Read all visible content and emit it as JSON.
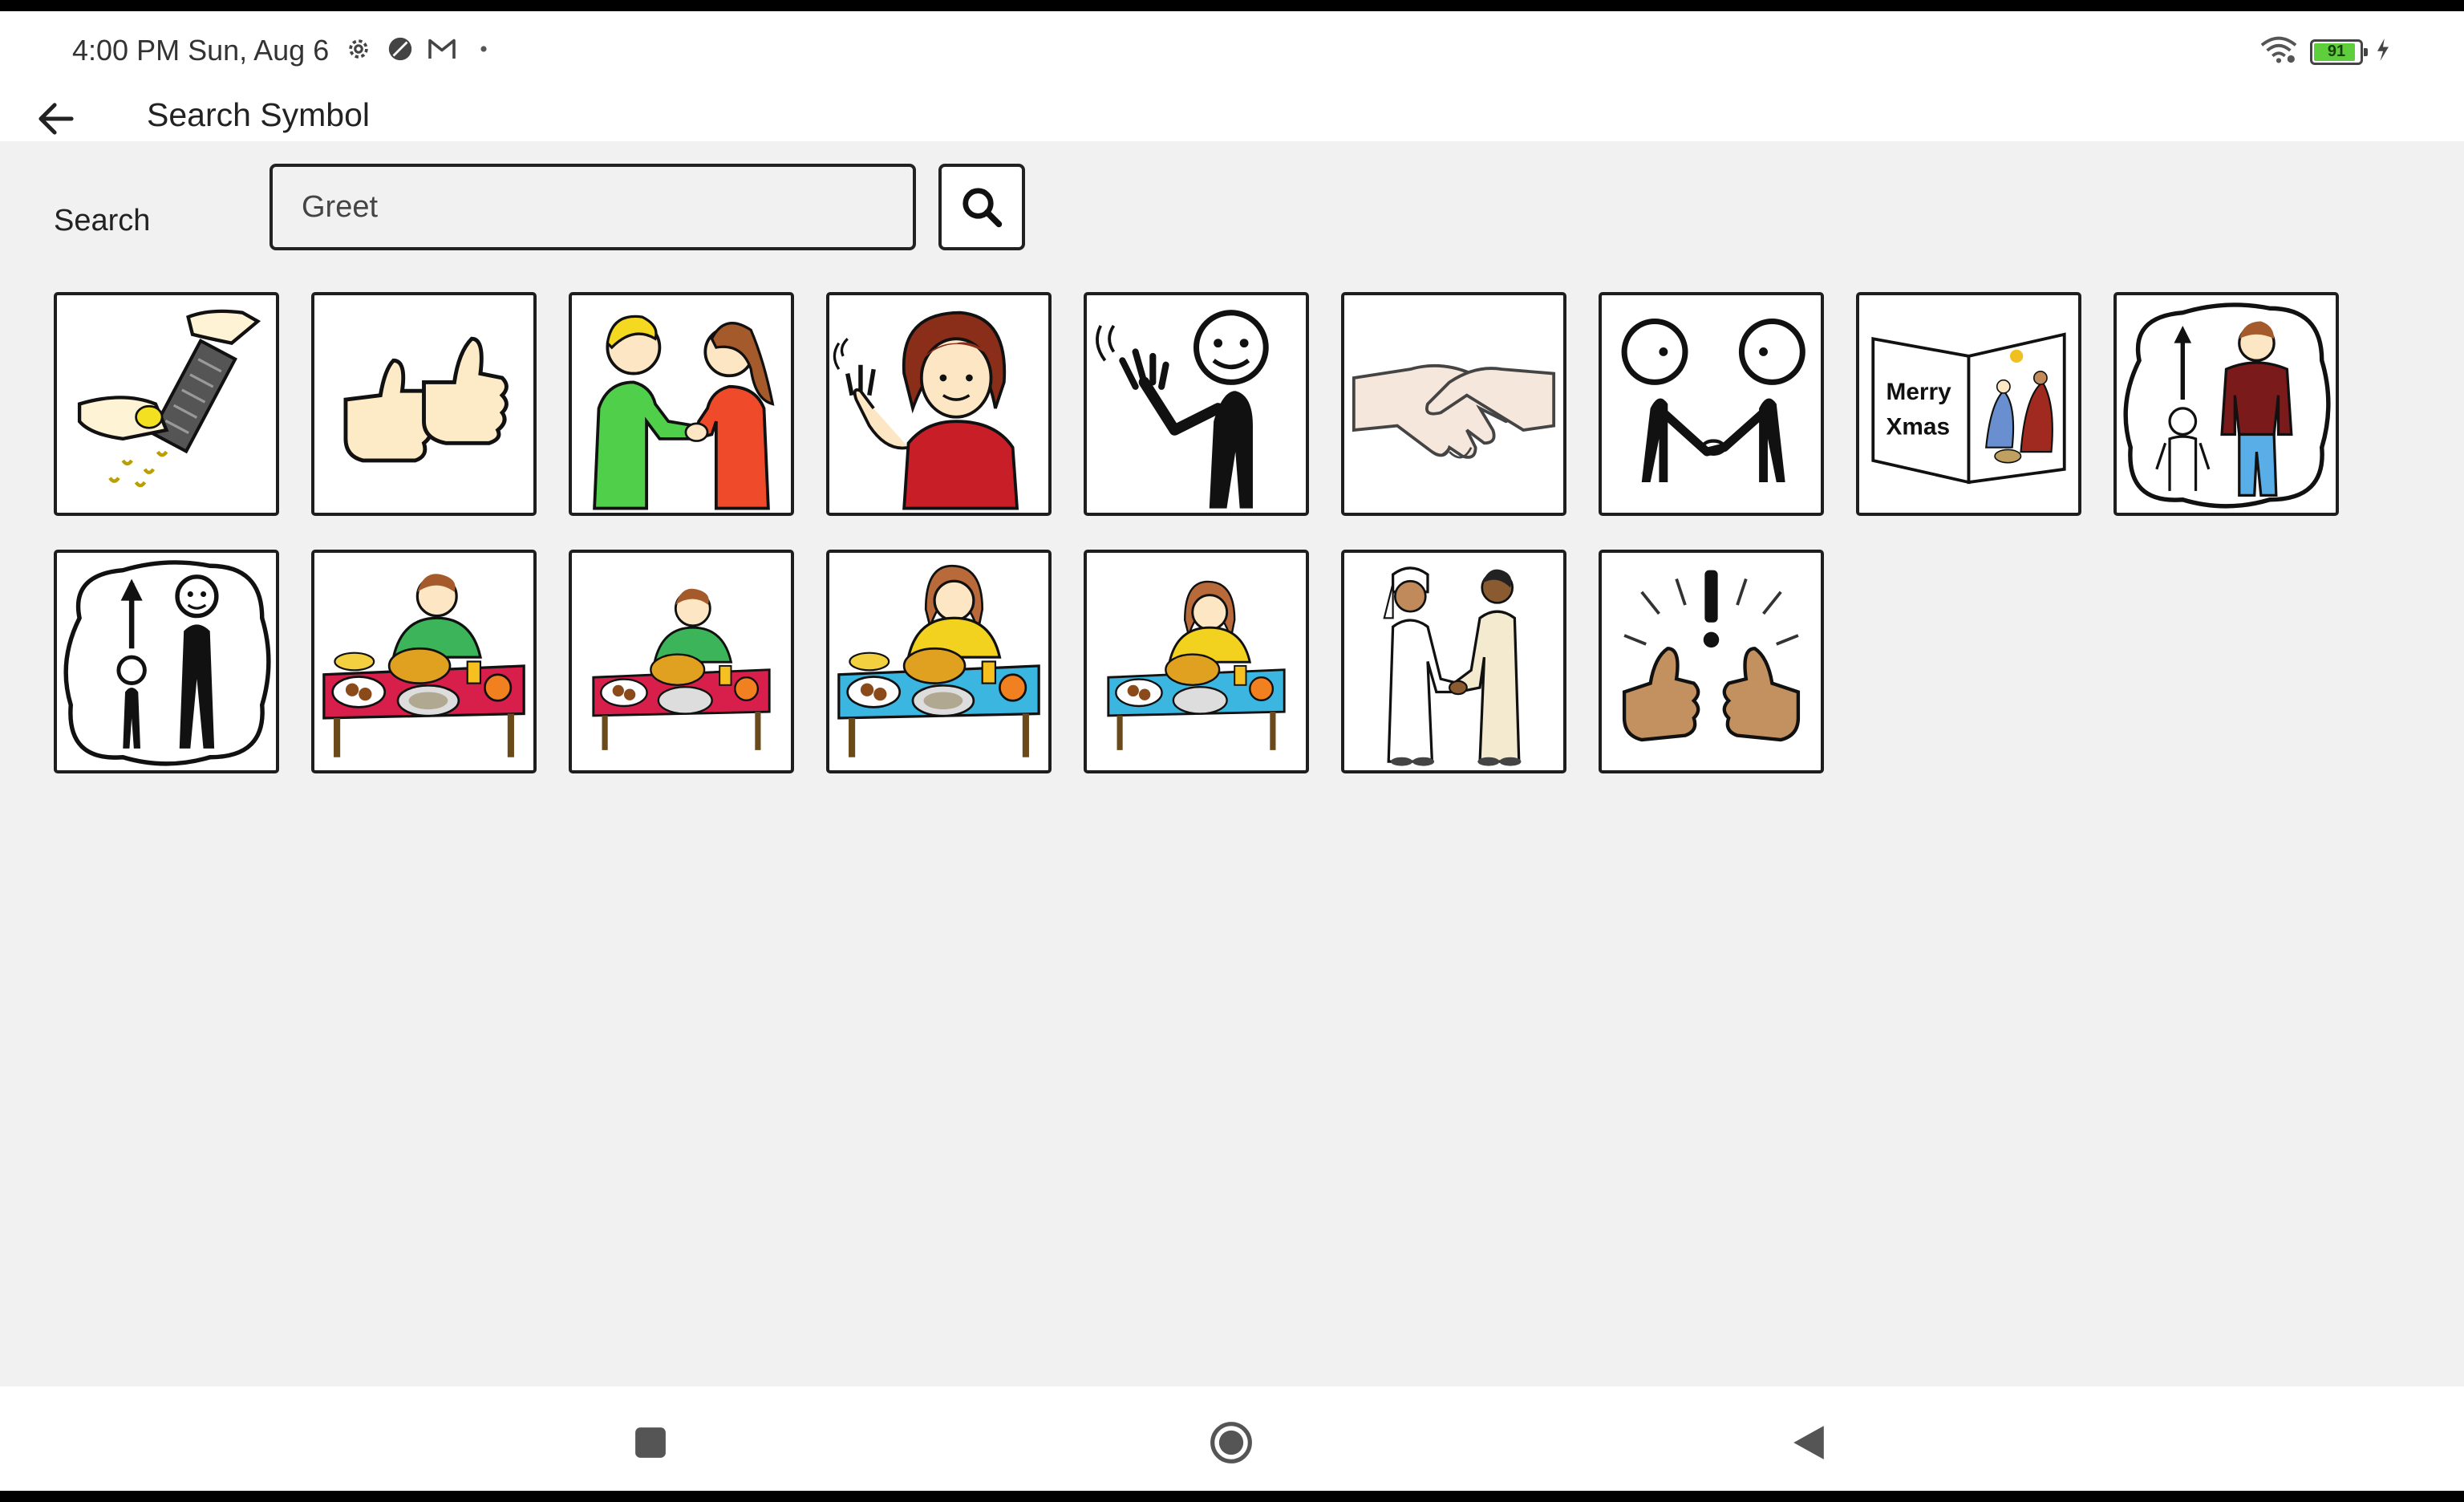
{
  "status_bar": {
    "time": "4:00 PM Sun, Aug 6",
    "notification_icons": [
      "settings-icon",
      "circle-slash-icon",
      "gmail-icon",
      "dot-icon"
    ],
    "battery_percent": "91",
    "battery_level": 0.91,
    "battery_color": "#5fce3c"
  },
  "header": {
    "title": "Search Symbol",
    "back_icon": "arrow-left-icon"
  },
  "search": {
    "label": "Search",
    "value": "Greet",
    "button_icon": "magnifier-icon"
  },
  "results": {
    "count": 16,
    "symbol_icons": [
      "grating-cheese-hands-icon",
      "two-thumbs-up-icon",
      "boy-girl-handshake-icon",
      "girl-waving-icon",
      "stick-figure-waving-icon",
      "handshake-icon",
      "stick-figures-handshake-icon",
      "merry-xmas-card-icon",
      "grown-man-with-child-icon",
      "stick-adult-child-icon",
      "boy-eating-feast-icon",
      "boy-eating-feast-small-icon",
      "girl-eating-feast-icon",
      "girl-eating-feast-small-icon",
      "two-men-handshake-icon",
      "thumbs-up-exclaim-icon"
    ],
    "card_text": [
      "Merry",
      "Xmas"
    ]
  },
  "nav": {
    "recents_icon": "square-icon",
    "home_icon": "circle-icon",
    "back_icon": "triangle-back-icon"
  }
}
